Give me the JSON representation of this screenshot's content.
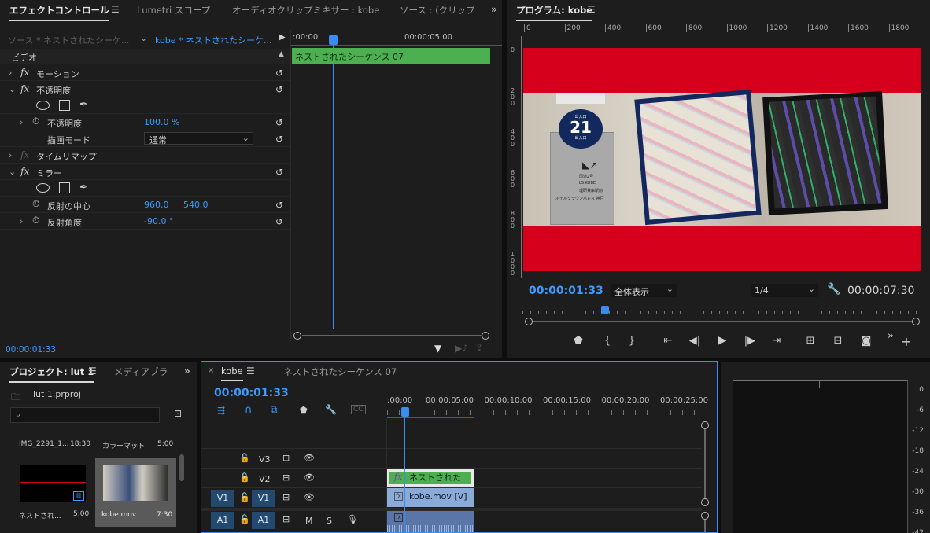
{
  "effect_controls": {
    "tabs": [
      "エフェクトコントロール",
      "Lumetri スコープ",
      "オーディオクリップミキサー : kobe",
      "ソース : (クリップな"
    ],
    "source_label": "ソース * ネストされたシーケ...",
    "sequence_label": "kobe * ネストされたシーケ...",
    "ruler_start": ":00:00",
    "ruler_mid": "00:00:05:00",
    "clip_name": "ネストされたシーケンス 07",
    "section_video": "ビデオ",
    "rows": {
      "motion": "モーション",
      "opacity": "不透明度",
      "opacity_param": "不透明度",
      "opacity_value": "100.0 %",
      "blend_mode_label": "描画モード",
      "blend_mode_value": "通常",
      "time_remap": "タイムリマップ",
      "mirror": "ミラー",
      "reflect_center": "反射の中心",
      "reflect_center_x": "960.0",
      "reflect_center_y": "540.0",
      "reflect_angle": "反射角度",
      "reflect_angle_value": "-90.0 °"
    },
    "timecode": "00:00:01:33"
  },
  "program": {
    "title": "プログラム: kobe",
    "ruler_labels": [
      "0",
      "200",
      "400",
      "600",
      "800",
      "1000",
      "1200",
      "1400",
      "1600",
      "1800"
    ],
    "vruler_labels": [
      "0",
      "200",
      "400",
      "600",
      "800",
      "1000"
    ],
    "current_time": "00:00:01:33",
    "fit": "全体表示",
    "resolution": "1/4",
    "duration": "00:00:07:30",
    "sign_number": "21",
    "sign_top": "出入口",
    "sign_exit": "出入口",
    "sign_lines": [
      "国道2号",
      "LS KOBE",
      "理研兵庫駅前",
      "ホテルクラウンパレス 神戸"
    ],
    "colors": {
      "bar": "#d6001c",
      "accent": "#3b9cff"
    }
  },
  "project": {
    "tabs": [
      "プロジェクト: lut 1",
      "メディアブラ"
    ],
    "file": "lut 1.prproj",
    "search_placeholder": "",
    "items": [
      {
        "name": "IMG_2291_1...",
        "duration": "18:30"
      },
      {
        "name": "カラーマット",
        "duration": "5:00"
      },
      {
        "name": "ネストされ...",
        "duration": "5:00"
      },
      {
        "name": "kobe.mov",
        "duration": "7:30"
      }
    ]
  },
  "timeline": {
    "tabs": [
      "kobe",
      "ネストされたシーケンス 07"
    ],
    "timecode": "00:00:01:33",
    "ruler": [
      ":00:00",
      "00:00:05:00",
      "00:00:10:00",
      "00:00:15:00",
      "00:00:20:00",
      "00:00:25:00"
    ],
    "tracks": {
      "v3": "V3",
      "v2": "V2",
      "v1": "V1",
      "v1_src": "V1",
      "a1": "A1",
      "a1_src": "A1",
      "m": "M",
      "s": "S"
    },
    "clips": {
      "nested": "ネストされた",
      "kobe": "kobe.mov [V]"
    }
  },
  "meter": {
    "labels": [
      "0",
      "-6",
      "-12",
      "-18",
      "-24",
      "-30",
      "-36",
      "-42"
    ]
  }
}
